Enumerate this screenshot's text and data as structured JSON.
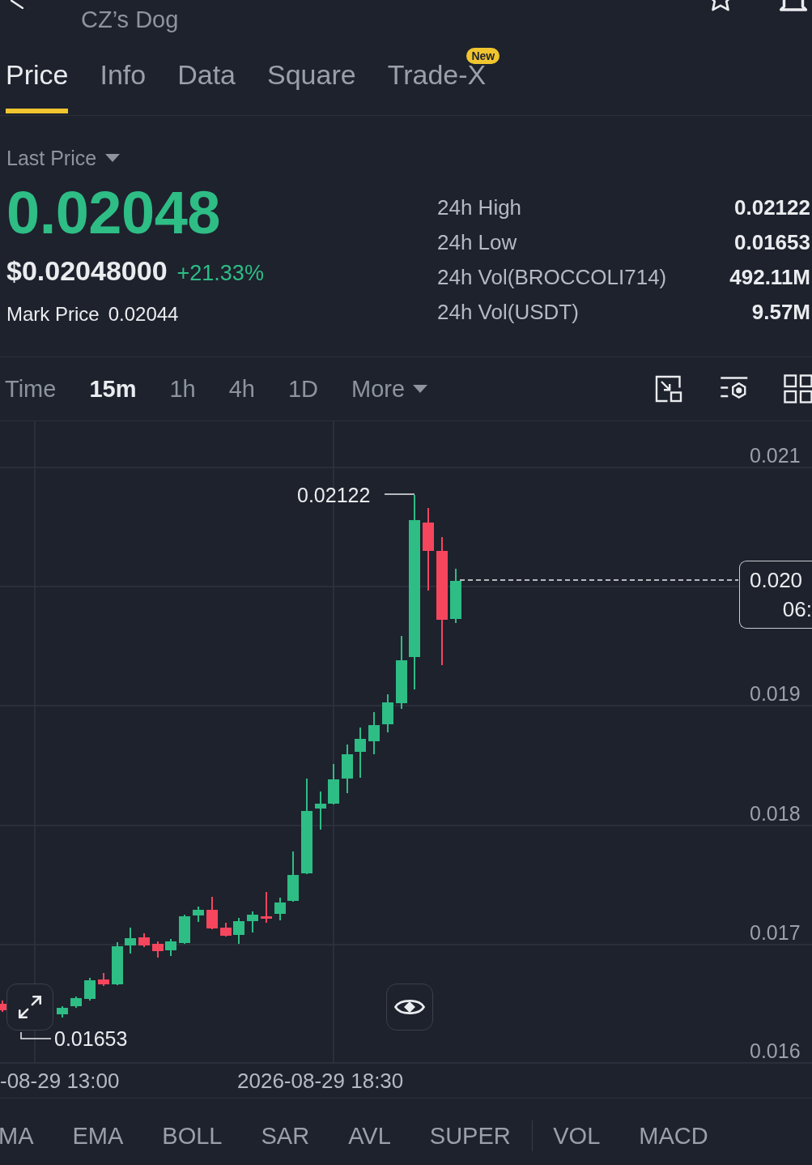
{
  "header": {
    "subtitle": "CZ’s Dog"
  },
  "tabs": [
    {
      "label": "Price",
      "selected": true
    },
    {
      "label": "Info",
      "selected": false
    },
    {
      "label": "Data",
      "selected": false
    },
    {
      "label": "Square",
      "selected": false
    },
    {
      "label": "Trade-X",
      "selected": false,
      "badge": "New"
    }
  ],
  "price_panel": {
    "selector": "Last Price",
    "last_price": "0.02048",
    "usd_price": "$0.02048000",
    "change": "+21.33%",
    "mark_price_label": "Mark Price",
    "mark_price": "0.02044"
  },
  "stats": [
    {
      "label": "24h High",
      "value": "0.02122"
    },
    {
      "label": "24h Low",
      "value": "0.01653"
    },
    {
      "label": "24h Vol(BROCCOLI714)",
      "value": "492.11M"
    },
    {
      "label": "24h Vol(USDT)",
      "value": "9.57M"
    }
  ],
  "intervals": [
    {
      "label": "Time",
      "kind": "interval",
      "selected": false
    },
    {
      "label": "15m",
      "kind": "interval",
      "selected": true
    },
    {
      "label": "1h",
      "kind": "interval",
      "selected": false
    },
    {
      "label": "4h",
      "kind": "interval",
      "selected": false
    },
    {
      "label": "1D",
      "kind": "interval",
      "selected": false
    },
    {
      "label": "More",
      "kind": "menu",
      "selected": false
    }
  ],
  "chart": {
    "y_labels": [
      "0.021",
      "0.019",
      "0.018",
      "0.017",
      "0.016"
    ],
    "high_label": "0.02122",
    "low_label": "0.01653",
    "price_tag": {
      "price": "0.020",
      "countdown": "06:"
    },
    "x_labels": [
      "-08-29 13:00",
      "2026-08-29 18:30"
    ]
  },
  "indicator_groups": [
    {
      "items": [
        "MA",
        "EMA",
        "BOLL",
        "SAR",
        "AVL",
        "SUPER"
      ]
    },
    {
      "items": [
        "VOL",
        "MACD"
      ]
    }
  ]
}
